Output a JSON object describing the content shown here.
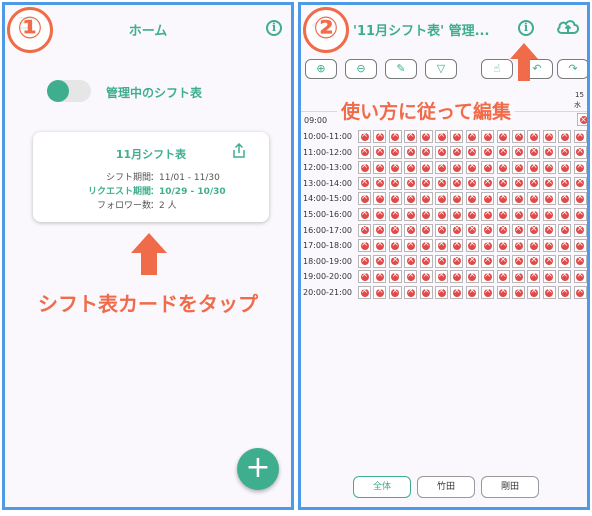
{
  "left": {
    "step": "①",
    "header_title": "ホーム",
    "info_glyph": "i",
    "toggle_label": "管理中のシフト表",
    "card": {
      "title": "11月シフト表",
      "shift_label": "シフト期間",
      "shift_value": "：11/01 - 11/30",
      "request_label": "リクエスト期間",
      "request_value": "：10/29 - 10/30",
      "follower_label": "フォロワー数",
      "follower_value": "：2 人"
    },
    "annotation": "シフト表カードをタップ",
    "fab_glyph": "+"
  },
  "right": {
    "step": "②",
    "header_title": "'11月シフト表' 管理...",
    "info_glyph": "i",
    "annotation": "使い方に従って編集",
    "toolbar": [
      "⊕",
      "⊖",
      "✎",
      "▽",
      "☝",
      "↶",
      "↷"
    ],
    "date_num": "15",
    "date_day": "水",
    "first_time": "09:00",
    "times": [
      "10:00-11:00",
      "11:00-12:00",
      "12:00-13:00",
      "13:00-14:00",
      "14:00-15:00",
      "15:00-16:00",
      "16:00-17:00",
      "17:00-18:00",
      "18:00-19:00",
      "19:00-20:00",
      "20:00-21:00"
    ],
    "bottom_buttons": [
      "全体",
      "竹田",
      "剛田"
    ]
  },
  "colors": {
    "accent": "#3fae8f",
    "annotation": "#f06b49",
    "border": "#4f9ae6",
    "cell_x": "#e24a4a"
  }
}
